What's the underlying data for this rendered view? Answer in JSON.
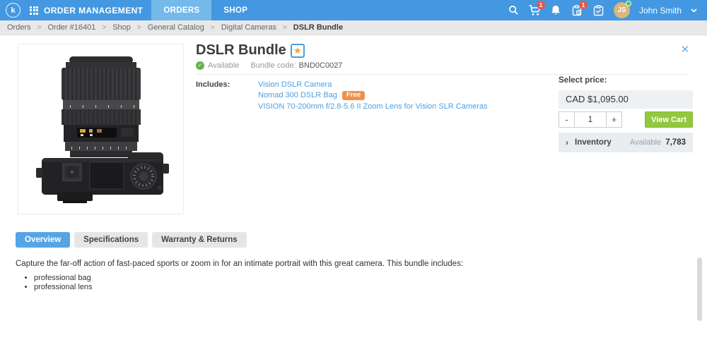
{
  "navbar": {
    "logo_letter": "k",
    "app_title": "ORDER MANAGEMENT",
    "tabs": [
      {
        "label": "ORDERS"
      },
      {
        "label": "SHOP"
      }
    ],
    "cart_badge": "1",
    "tasks_badge": "1",
    "user": {
      "initials": "JS",
      "name": "John Smith"
    }
  },
  "breadcrumb": {
    "separator": ">",
    "items": [
      "Orders",
      "Order #16401",
      "Shop",
      "General Catalog",
      "Digital Cameras",
      "DSLR Bundle"
    ]
  },
  "product": {
    "title": "DSLR Bundle",
    "star_icon": "★",
    "availability": "Available",
    "check_glyph": "✓",
    "bundle_code_label": "Bundle code:",
    "bundle_code": "BND0C0027",
    "includes_label": "Includes:",
    "includes": [
      {
        "label": "Vision DSLR Camera"
      },
      {
        "label": "Nomad 300 DSLR Bag",
        "badge": "Free"
      },
      {
        "label": "VISION 70-200mm f/2.8-5.6 II Zoom Lens for Vision SLR Cameras"
      }
    ]
  },
  "purchase": {
    "select_price_label": "Select price:",
    "price": "CAD $1,095.00",
    "minus_label": "-",
    "quantity": "1",
    "plus_label": "+",
    "view_cart_label": "View Cart",
    "inventory_label": "Inventory",
    "inventory_chevron": "›",
    "available_label": "Available",
    "available_count": "7,783"
  },
  "content_tabs": [
    {
      "label": "Overview"
    },
    {
      "label": "Specifications"
    },
    {
      "label": "Warranty & Returns"
    }
  ],
  "overview": {
    "description": "Capture the far-off action of fast-paced sports or zoom in for an intimate portrait with this great camera. This bundle includes:",
    "bullets": [
      "professional bag",
      "professional lens"
    ]
  },
  "misc": {
    "close_glyph": "✕"
  },
  "colors": {
    "navbar_blue": "#4398e1",
    "active_nav_tab_blue": "#74b9ea",
    "active_tab_blue": "#55a5e6",
    "link_blue": "#4f9edd",
    "free_badge_orange": "#f0914a",
    "view_cart_green": "#92c83f",
    "notification_red": "#e8564a",
    "star_gold": "#f0a33a",
    "availability_green": "#67b246",
    "avatar_tan": "#d8b77d"
  }
}
